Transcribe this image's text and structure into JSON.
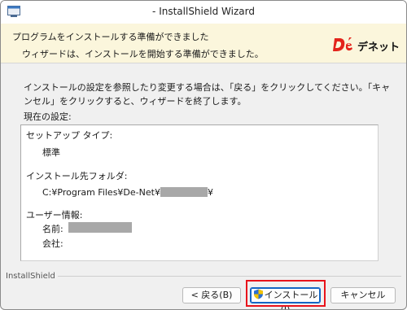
{
  "window": {
    "title": "- InstallShield Wizard"
  },
  "header": {
    "title": "プログラムをインストールする準備ができました",
    "subtitle": "ウィザードは、インストールを開始する準備ができました。",
    "logo_text": "デネット"
  },
  "body": {
    "description": "インストールの設定を参照したり変更する場合は、「戻る」をクリックしてください。「キャンセル」をクリックすると、ウィザードを終了します。",
    "current_settings_label": "現在の設定:",
    "settings": {
      "setup_type_label": "セットアップ タイプ:",
      "setup_type_value": "標準",
      "dest_folder_label": "インストール先フォルダ:",
      "dest_folder_prefix": "C:¥Program Files¥De-Net¥",
      "dest_folder_suffix": "¥",
      "user_info_label": "ユーザー情報:",
      "name_label": "名前:",
      "company_label": "会社:"
    }
  },
  "footer": {
    "brand": "InstallShield",
    "back_label": "< 戻る(B)",
    "install_label": "インストール(I)",
    "cancel_label": "キャンセル"
  },
  "colors": {
    "header_bg": "#fbf6dc",
    "highlight": "#e8131b",
    "default_button": "#1466c4",
    "redaction": "#a8a8a8"
  }
}
